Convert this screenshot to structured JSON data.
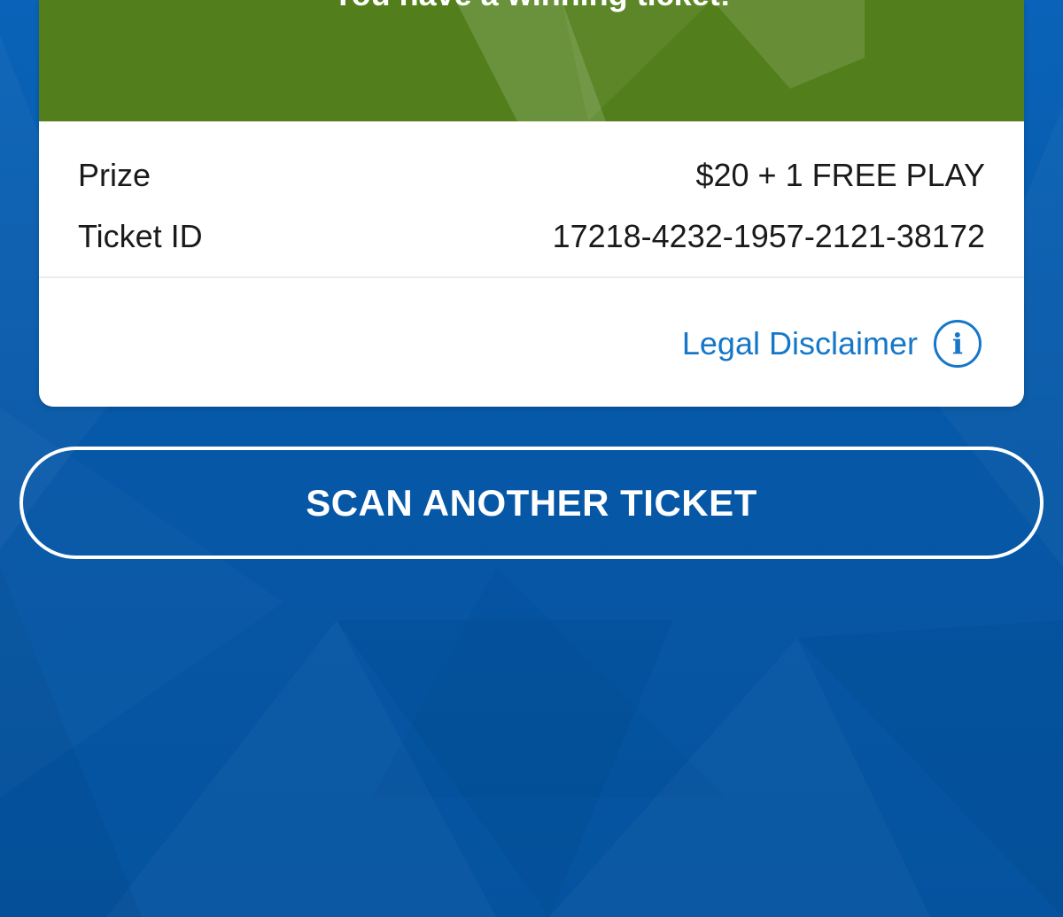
{
  "win_banner": {
    "message": "You have a winning ticket!",
    "color": "#527f1b"
  },
  "ticket_info": {
    "prize_label": "Prize",
    "prize_value": "$20 + 1 FREE PLAY",
    "ticket_id_label": "Ticket ID",
    "ticket_id_value": "17218-4232-1957-2121-38172"
  },
  "legal": {
    "link_label": "Legal Disclaimer",
    "icon": "info-icon",
    "icon_glyph": "i"
  },
  "actions": {
    "scan_label": "SCAN ANOTHER TICKET"
  },
  "colors": {
    "background": "#0658a8",
    "link": "#1677c8",
    "card": "#ffffff"
  }
}
